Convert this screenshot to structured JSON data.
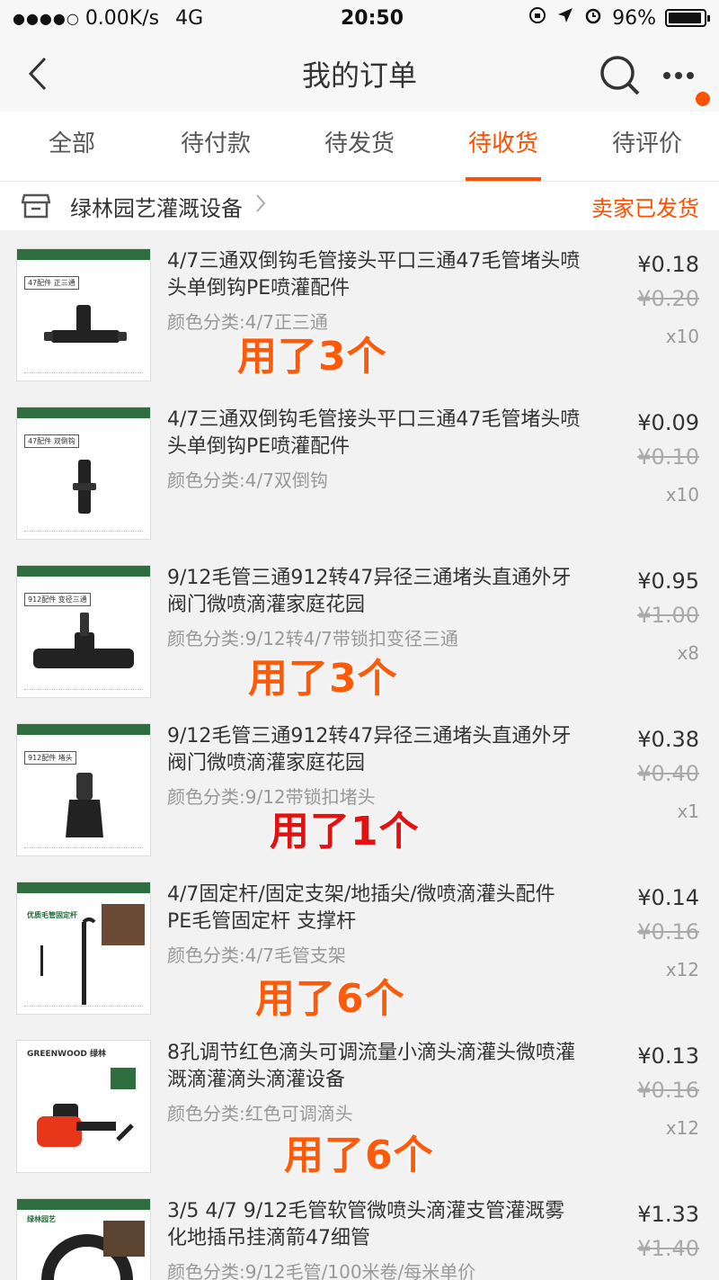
{
  "status": {
    "network_speed": "0.00K/s",
    "network_type": "4G",
    "time": "20:50",
    "battery": "96%",
    "battery_level": 0.96
  },
  "nav": {
    "title": "我的订单"
  },
  "tabs": [
    {
      "label": "全部",
      "active": false
    },
    {
      "label": "待付款",
      "active": false
    },
    {
      "label": "待发货",
      "active": false
    },
    {
      "label": "待收货",
      "active": true
    },
    {
      "label": "待评价",
      "active": false
    }
  ],
  "shop": {
    "name": "绿林园艺灌溉设备",
    "status": "卖家已发货"
  },
  "items": [
    {
      "title": "4/7三通双倒钩毛管接头平口三通47毛管堵头喷头单倒钩PE喷灌配件",
      "spec": "颜色分类:4/7正三通",
      "price": "¥0.18",
      "original_price": "¥0.20",
      "quantity": "x10",
      "note": "用了3个",
      "thumb_label": "47配件 正三通"
    },
    {
      "title": "4/7三通双倒钩毛管接头平口三通47毛管堵头喷头单倒钩PE喷灌配件",
      "spec": "颜色分类:4/7双倒钩",
      "price": "¥0.09",
      "original_price": "¥0.10",
      "quantity": "x10",
      "note": "",
      "thumb_label": "47配件 双倒钩"
    },
    {
      "title": "9/12毛管三通912转47异径三通堵头直通外牙阀门微喷滴灌家庭花园",
      "spec": "颜色分类:9/12转4/7带锁扣变径三通",
      "price": "¥0.95",
      "original_price": "¥1.00",
      "quantity": "x8",
      "note": "用了3个",
      "thumb_label": "912配件 变径三通"
    },
    {
      "title": "9/12毛管三通912转47异径三通堵头直通外牙阀门微喷滴灌家庭花园",
      "spec": "颜色分类:9/12带锁扣堵头",
      "price": "¥0.38",
      "original_price": "¥0.40",
      "quantity": "x1",
      "note": "用了1个",
      "thumb_label": "912配件 堵头"
    },
    {
      "title": "4/7固定杆/固定支架/地插尖/微喷滴灌头配件 PE毛管固定杆 支撑杆",
      "spec": "颜色分类:4/7毛管支架",
      "price": "¥0.14",
      "original_price": "¥0.16",
      "quantity": "x12",
      "note": "用了6个",
      "thumb_label": "优质毛管固定杆"
    },
    {
      "title": "8孔调节红色滴头可调流量小滴头滴灌头微喷灌溉滴灌滴头滴灌设备",
      "spec": "颜色分类:红色可调滴头",
      "price": "¥0.13",
      "original_price": "¥0.16",
      "quantity": "x12",
      "note": "用了6个",
      "thumb_label": "GREENWOOD 绿林"
    },
    {
      "title": "3/5 4/7 9/12毛管软管微喷头滴灌支管灌溉雾化地插吊挂滴箭47细管",
      "spec": "颜色分类:9/12毛管/100米卷/每米单价",
      "price": "¥1.33",
      "original_price": "¥1.40",
      "quantity": "",
      "note": "",
      "thumb_label": "绿林园艺"
    }
  ]
}
